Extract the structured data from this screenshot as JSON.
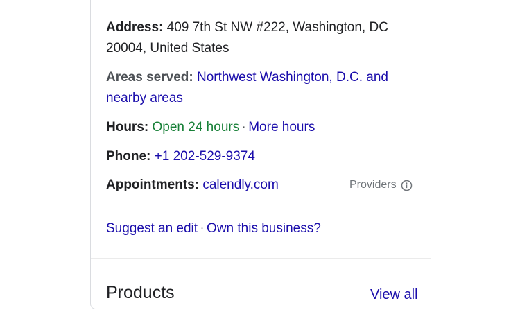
{
  "details": {
    "address_label": "Address:",
    "address_value": "409 7th St NW #222, Washington, DC 20004, United States",
    "areas_label": "Areas served:",
    "areas_value": "Northwest Washington, D.C. and nearby areas",
    "hours_label": "Hours:",
    "hours_status": "Open 24 hours",
    "separator": "·",
    "more_hours": "More hours",
    "phone_label": "Phone:",
    "phone_value": "+1 202-529-9374",
    "appointments_label": "Appointments:",
    "appointments_value": "calendly.com",
    "providers_label": "Providers"
  },
  "actions": {
    "suggest_edit": "Suggest an edit",
    "own_business": "Own this business?"
  },
  "products": {
    "heading": "Products",
    "view_all": "View all"
  },
  "colors": {
    "link": "#1a0dab",
    "open_status": "#188038",
    "text": "#202124",
    "muted": "#70757a"
  },
  "icons": {
    "providers": "info-icon"
  }
}
